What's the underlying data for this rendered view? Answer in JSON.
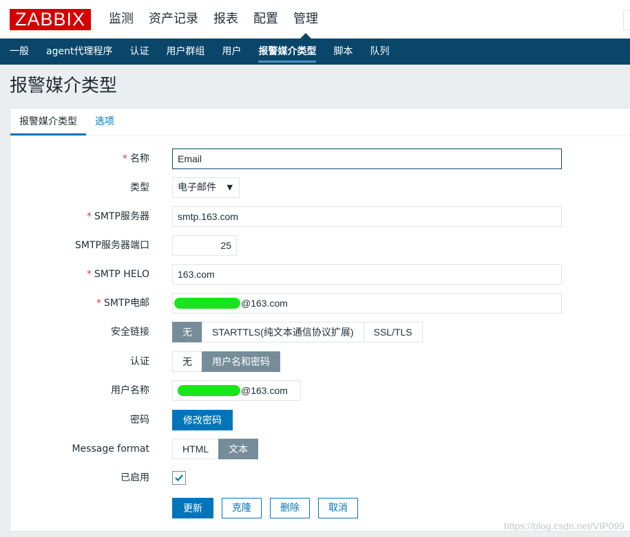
{
  "header": {
    "logo": "ZABBIX",
    "menu": [
      "监测",
      "资产记录",
      "报表",
      "配置",
      "管理"
    ],
    "active_menu": "管理"
  },
  "subnav": {
    "items": [
      "一般",
      "agent代理程序",
      "认证",
      "用户群组",
      "用户",
      "报警媒介类型",
      "脚本",
      "队列"
    ],
    "active": "报警媒介类型"
  },
  "page_title": "报警媒介类型",
  "tabs": [
    "报警媒介类型",
    "选项"
  ],
  "form": {
    "name": {
      "label": "名称",
      "value": "Email"
    },
    "type": {
      "label": "类型",
      "value": "电子邮件"
    },
    "smtp_server": {
      "label": "SMTP服务器",
      "value": "smtp.163.com"
    },
    "smtp_port": {
      "label": "SMTP服务器端口",
      "value": "25"
    },
    "smtp_helo": {
      "label": "SMTP HELO",
      "value": "163.com"
    },
    "smtp_email": {
      "label": "SMTP电邮",
      "value_suffix": "@163.com"
    },
    "security": {
      "label": "安全链接",
      "options": [
        "无",
        "STARTTLS(纯文本通信协议扩展)",
        "SSL/TLS"
      ],
      "selected": "无"
    },
    "auth": {
      "label": "认证",
      "options": [
        "无",
        "用户名和密码"
      ],
      "selected": "用户名和密码"
    },
    "username": {
      "label": "用户名称",
      "value_suffix": "@163.com"
    },
    "password": {
      "label": "密码",
      "button": "修改密码"
    },
    "message_format": {
      "label": "Message format",
      "options": [
        "HTML",
        "文本"
      ],
      "selected": "文本"
    },
    "enabled": {
      "label": "已启用",
      "checked": true
    }
  },
  "actions": {
    "update": "更新",
    "clone": "克隆",
    "delete": "删除",
    "cancel": "取消"
  },
  "watermark": "https://blog.csdn.net/VIP099",
  "colors": {
    "brand": "#d40000",
    "nav": "#0a466a",
    "accent": "#0275b8",
    "segment_on": "#768d99",
    "required": "#e33734",
    "redaction": "#19e619"
  }
}
